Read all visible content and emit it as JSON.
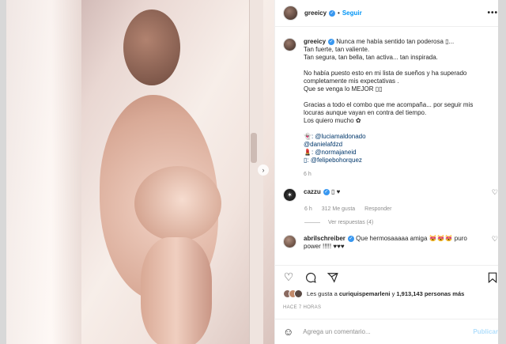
{
  "post": {
    "username": "greeicy",
    "follow_label": "Seguir",
    "more_label": "•••",
    "carousel_next": "›"
  },
  "caption": {
    "username": "greeicy",
    "lines": [
      "Nunca me había sentido tan poderosa ▯...\nTan fuerte, tan valiente.\nTan segura, tan bella, tan activa... tan inspirada.",
      "No había puesto esto en mi lista de sueños y ha superado completamente mis expectativas .\nQue se venga lo MEJOR ▯▯",
      "Gracias a todo el combo que me acompaña... por seguir mis locuras aunque vayan en contra del tiempo.\nLos quiero mucho ✿"
    ],
    "tags": [
      "👻: @luciamaldonado",
      "@danielafdzd",
      "💄: @normajaneid",
      "▯: @felipebohorquez"
    ],
    "time": "6 h"
  },
  "comments": [
    {
      "username": "cazzu",
      "text": "▯ ♥",
      "time": "6 h",
      "likes": "312 Me gusta",
      "reply_label": "Responder",
      "view_replies": "Ver respuestas (4)"
    },
    {
      "username": "abrilschreiber",
      "text": "Que hermosaaaaa amiga 😻😻😻 puro power !!!!! ♥♥♥"
    }
  ],
  "actions": {
    "like_icon": "heart-icon",
    "comment_icon": "comment-icon",
    "share_icon": "share-icon",
    "save_icon": "bookmark-icon"
  },
  "likes": {
    "prefix": "Les gusta a ",
    "first_user": "curiquispemarleni",
    "middle": " y ",
    "count": "1,913,143 personas más"
  },
  "time_ago": "HACE 7 HORAS",
  "compose": {
    "placeholder": "Agrega un comentario...",
    "publish_label": "Publicar"
  }
}
